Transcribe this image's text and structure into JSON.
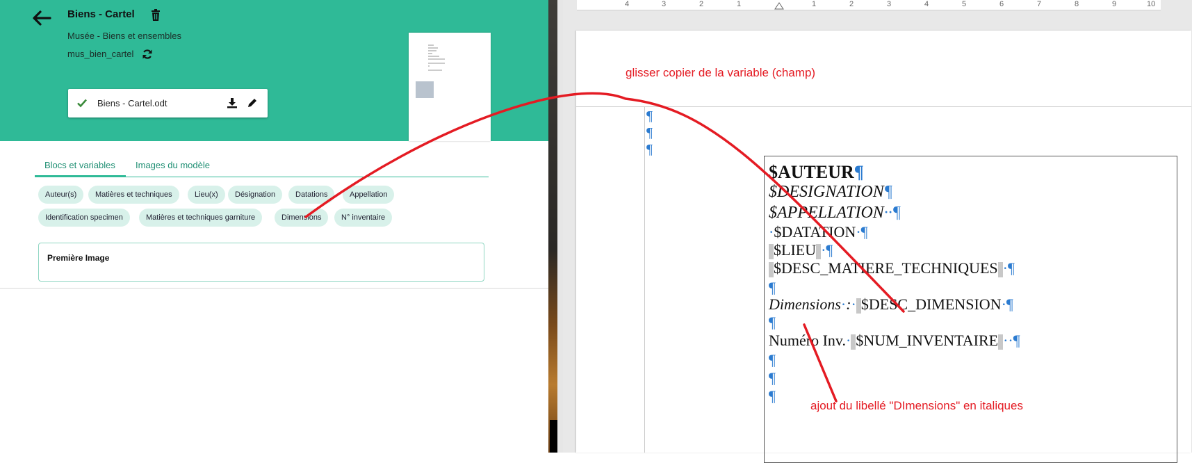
{
  "app": {
    "title": "Biens - Cartel",
    "subtitle": "Musée - Biens et ensembles",
    "code": "mus_bien_cartel",
    "file": {
      "name": "Biens - Cartel.odt"
    },
    "tabs": [
      {
        "label": "Blocs et variables",
        "active": true
      },
      {
        "label": "Images du modèle",
        "active": false
      }
    ],
    "chips": [
      "Auteur(s)",
      "Matières et techniques",
      "Lieu(x)",
      "Désignation",
      "Datations",
      "Appellation",
      "Identification specimen",
      "Matières et techniques garniture",
      "Dimensions",
      "N° inventaire"
    ],
    "first_image_label": "Première Image",
    "accent_color": "#2fba97"
  },
  "writer": {
    "ruler": [
      "4",
      "3",
      "2",
      "1",
      "1",
      "2",
      "3",
      "4",
      "5",
      "6",
      "7",
      "8",
      "9",
      "10"
    ],
    "pilcrow": "¶",
    "lines": {
      "auteur": "$AUTEUR",
      "designation": "$DESIGNATION",
      "appellation": "$APPELLATION",
      "datation": "$DATATION",
      "lieu": "$LIEU",
      "desc_matiere": "$DESC_MATIERE_TECHNIQUES",
      "dimensions_label": "Dimensions",
      "dimensions_var": "$DESC_DIMENSION",
      "numero_label": "Numéro Inv.",
      "num_var": "$NUM_INVENTAIRE"
    }
  },
  "annotations": {
    "top": "glisser copier de la variable (champ)",
    "bottom": "ajout du libellé \"DImensions\" en italiques",
    "color": "#e41b23"
  }
}
